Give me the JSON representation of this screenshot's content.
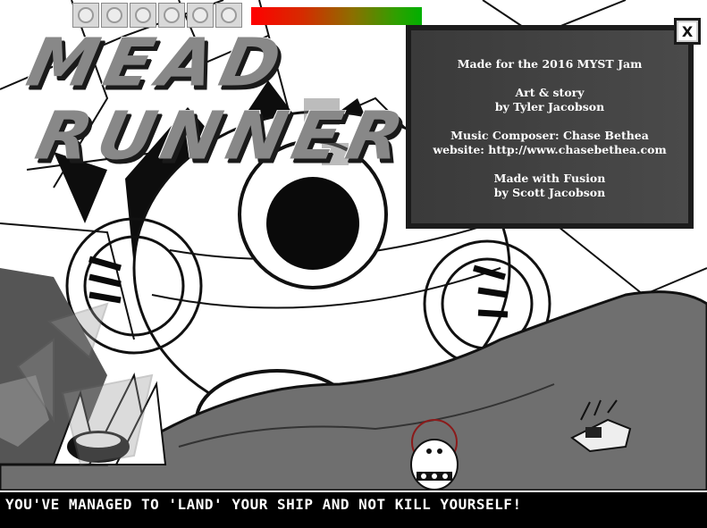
{
  "game": {
    "title_line1": "MEAD",
    "title_line2": "RUNNER"
  },
  "hud": {
    "inventory_slots": 6,
    "health_fraction": 1.0
  },
  "credits": {
    "line1": "Made for the 2016 MYST Jam",
    "line2": "Art & story",
    "line3": "by Tyler Jacobson",
    "line4": "Music Composer: Chase Bethea",
    "line5": "website: http://www.chasebethea.com",
    "line6": "Made with Fusion",
    "line7": "by Scott Jacobson",
    "close_label": "X"
  },
  "message": {
    "text": "YOU'VE MANAGED TO 'LAND' YOUR SHIP AND NOT KILL YOURSELF!"
  },
  "colors": {
    "background": "#ffffff",
    "panel": "#3a3a3a",
    "message_bar": "#000000",
    "health_start": "#ff0000",
    "health_end": "#00b000"
  }
}
